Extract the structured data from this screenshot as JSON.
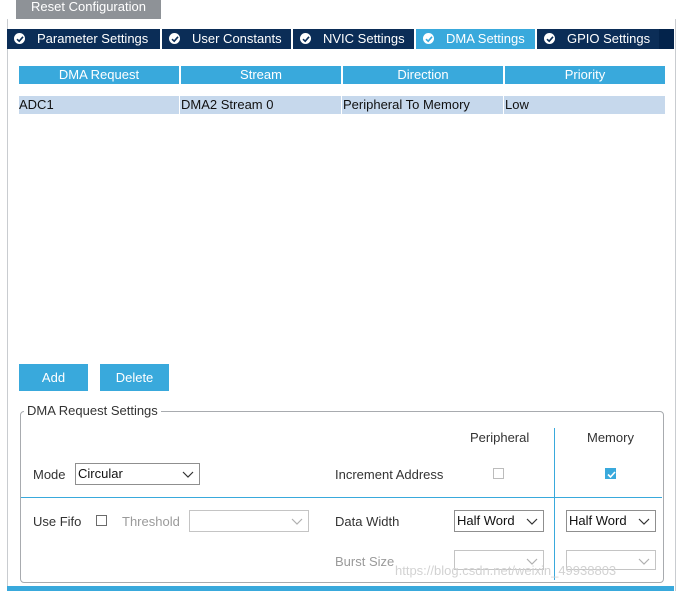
{
  "toolbar": {
    "reset_label": "Reset Configuration"
  },
  "tabs": [
    {
      "label": "Parameter Settings",
      "active": false
    },
    {
      "label": "User Constants",
      "active": false
    },
    {
      "label": "NVIC Settings",
      "active": false
    },
    {
      "label": "DMA Settings",
      "active": true
    },
    {
      "label": "GPIO Settings",
      "active": false
    }
  ],
  "table": {
    "columns": [
      "DMA Request",
      "Stream",
      "Direction",
      "Priority"
    ],
    "rows": [
      [
        "ADC1",
        "DMA2 Stream 0",
        "Peripheral To Memory",
        "Low"
      ]
    ]
  },
  "buttons": {
    "add": "Add",
    "delete": "Delete"
  },
  "settings": {
    "title": "DMA Request Settings",
    "peripheral_header": "Peripheral",
    "memory_header": "Memory",
    "mode_label": "Mode",
    "mode_value": "Circular",
    "increment_label": "Increment Address",
    "increment_peripheral": false,
    "increment_memory": true,
    "use_fifo_label": "Use Fifo",
    "use_fifo": false,
    "threshold_label": "Threshold",
    "threshold_value": "",
    "data_width_label": "Data Width",
    "data_width_peripheral": "Half Word",
    "data_width_memory": "Half Word",
    "burst_size_label": "Burst Size",
    "burst_peripheral": "",
    "burst_memory": ""
  },
  "watermark": "https://blog.csdn.net/weixin_49938803",
  "colors": {
    "accent": "#39a9dc",
    "tab_bg": "#0b2d57",
    "row_selected": "#c6d8ec"
  }
}
